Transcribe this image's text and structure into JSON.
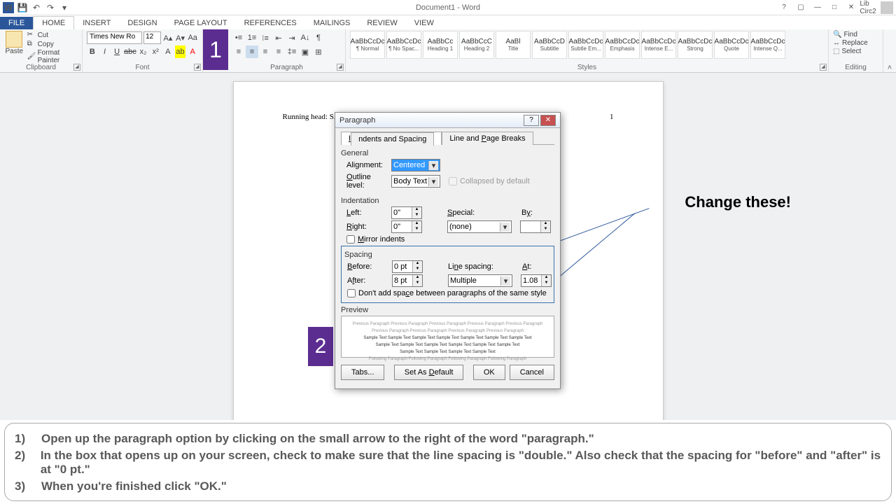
{
  "titlebar": {
    "doc_title": "Document1 - Word",
    "user": "Lib Circ2"
  },
  "tabs": {
    "file": "FILE",
    "home": "HOME",
    "insert": "INSERT",
    "design": "DESIGN",
    "page_layout": "PAGE LAYOUT",
    "references": "REFERENCES",
    "mailings": "MAILINGS",
    "review": "REVIEW",
    "view": "VIEW"
  },
  "clipboard": {
    "paste": "Paste",
    "cut": "Cut",
    "copy": "Copy",
    "format_painter": "Format Painter",
    "label": "Clipboard"
  },
  "font": {
    "name": "Times New Ro",
    "size": "12",
    "label": "Font"
  },
  "paragraph": {
    "label": "Paragraph"
  },
  "styles": {
    "label": "Styles",
    "items": [
      {
        "prev": "AaBbCcDc",
        "name": "¶ Normal"
      },
      {
        "prev": "AaBbCcDc",
        "name": "¶ No Spac..."
      },
      {
        "prev": "AaBbCc",
        "name": "Heading 1"
      },
      {
        "prev": "AaBbCcC",
        "name": "Heading 2"
      },
      {
        "prev": "AaBl",
        "name": "Title"
      },
      {
        "prev": "AaBbCcD",
        "name": "Subtitle"
      },
      {
        "prev": "AaBbCcDc",
        "name": "Subtle Em..."
      },
      {
        "prev": "AaBbCcDc",
        "name": "Emphasis"
      },
      {
        "prev": "AaBbCcDc",
        "name": "Intense E..."
      },
      {
        "prev": "AaBbCcDc",
        "name": "Strong"
      },
      {
        "prev": "AaBbCcDc",
        "name": "Quote"
      },
      {
        "prev": "AaBbCcDc",
        "name": "Intense Q..."
      }
    ]
  },
  "editing": {
    "find": "Find",
    "replace": "Replace",
    "select": "Select",
    "label": "Editing"
  },
  "document": {
    "running_head": "Running head: SAMPLE APA PAPER",
    "page_num": "1"
  },
  "callouts": {
    "c1": "1",
    "c2": "2",
    "annotation": "Change these!"
  },
  "dialog": {
    "title": "Paragraph",
    "tab1": "Indents and Spacing",
    "tab2": "Line and Page Breaks",
    "general": "General",
    "alignment_label": "Alignment:",
    "alignment": "Centered",
    "outline_label": "Outline level:",
    "outline": "Body Text",
    "collapsed": "Collapsed by default",
    "indentation": "Indentation",
    "left_label": "Left:",
    "left": "0\"",
    "right_label": "Right:",
    "right": "0\"",
    "special_label": "Special:",
    "special": "(none)",
    "by_label": "By:",
    "by": "",
    "mirror": "Mirror indents",
    "spacing": "Spacing",
    "before_label": "Before:",
    "before": "0 pt",
    "after_label": "After:",
    "after": "8 pt",
    "line_spacing_label": "Line spacing:",
    "line_spacing": "Multiple",
    "at_label": "At:",
    "at": "1.08",
    "dont_add": "Don't add space between paragraphs of the same style",
    "preview": "Preview",
    "tabs_btn": "Tabs...",
    "default_btn": "Set As Default",
    "ok": "OK",
    "cancel": "Cancel"
  },
  "instructions": [
    "Open up the paragraph option by clicking on the small arrow to the right of the word \"paragraph.\"",
    "In the box that opens up on your screen, check to make sure that the line spacing is \"double.\"  Also check that the spacing for \"before\" and \"after\" is at \"0 pt.\"",
    "When you're finished click \"OK.\""
  ]
}
